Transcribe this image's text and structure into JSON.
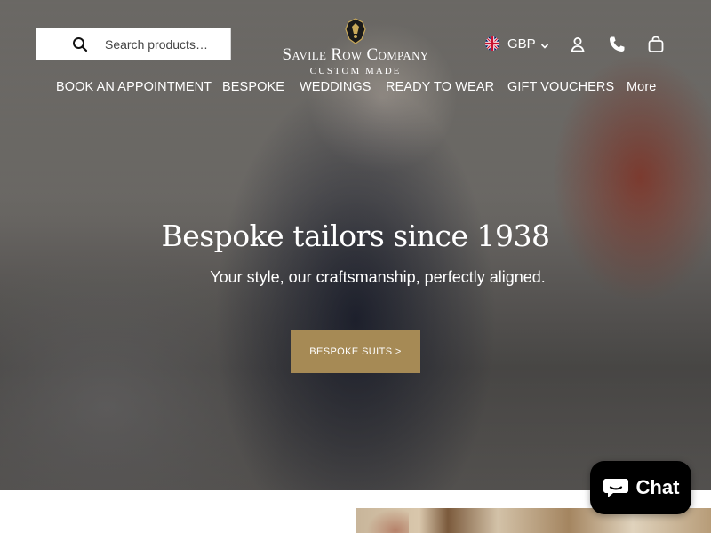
{
  "header": {
    "search": {
      "placeholder": "Search products…",
      "value": ""
    },
    "logo": {
      "name": "Savile Row Company",
      "tagline": "CUSTOM MADE"
    },
    "currency": {
      "code": "GBP"
    },
    "icons": [
      "search-icon",
      "uk-flag-icon",
      "chevron-down-icon",
      "account-icon",
      "phone-icon",
      "cart-icon"
    ]
  },
  "nav": {
    "items": [
      {
        "label": "BOOK AN APPOINTMENT"
      },
      {
        "label": "BESPOKE"
      },
      {
        "label": "WEDDINGS"
      },
      {
        "label": "READY TO WEAR"
      },
      {
        "label": "GIFT VOUCHERS"
      },
      {
        "label": "More"
      }
    ]
  },
  "hero": {
    "title": "Bespoke tailors since 1938",
    "subtitle": "Your style, our craftsmanship, perfectly aligned.",
    "cta_label": "BESPOKE SUITS >"
  },
  "chat": {
    "label": "Chat"
  },
  "colors": {
    "cta": "#a68a55",
    "chat_bg": "#000000",
    "text_on_hero": "#ffffff"
  }
}
